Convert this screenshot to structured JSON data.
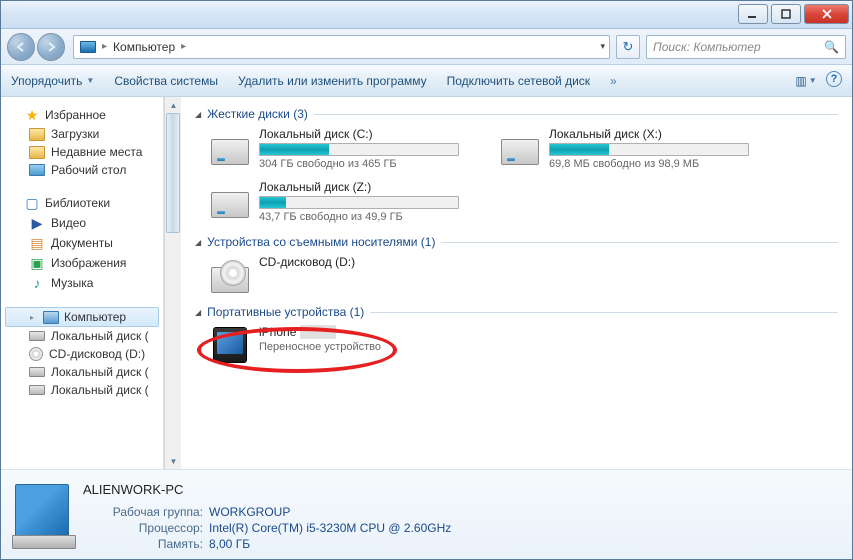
{
  "address": {
    "location": "Компьютер",
    "search_placeholder": "Поиск: Компьютер"
  },
  "toolbar": {
    "organize": "Упорядочить",
    "sysprops": "Свойства системы",
    "uninstall": "Удалить или изменить программу",
    "netdrive": "Подключить сетевой диск"
  },
  "sidebar": {
    "favorites": {
      "label": "Избранное",
      "downloads": "Загрузки",
      "recent": "Недавние места",
      "desktop": "Рабочий стол"
    },
    "libraries": {
      "label": "Библиотеки",
      "video": "Видео",
      "documents": "Документы",
      "pictures": "Изображения",
      "music": "Музыка"
    },
    "computer": {
      "label": "Компьютер",
      "c": "Локальный диск (",
      "d": "CD-дисковод (D:)",
      "x": "Локальный диск (",
      "z": "Локальный диск ("
    }
  },
  "sections": {
    "hdd": "Жесткие диски (3)",
    "removable": "Устройства со съемными носителями (1)",
    "portable": "Портативные устройства (1)"
  },
  "drives": {
    "c": {
      "name": "Локальный диск (C:)",
      "stat": "304 ГБ свободно из 465 ГБ",
      "fill": 35
    },
    "x": {
      "name": "Локальный диск (X:)",
      "stat": "69,8 МБ свободно из 98,9 МБ",
      "fill": 30
    },
    "z": {
      "name": "Локальный диск (Z:)",
      "stat": "43,7 ГБ свободно из 49,9 ГБ",
      "fill": 13
    },
    "d": {
      "name": "CD-дисковод (D:)"
    },
    "iphone": {
      "name": "iPhone",
      "sub": "Переносное устройство"
    }
  },
  "details": {
    "pcname": "ALIENWORK-PC",
    "workgroup_label": "Рабочая группа:",
    "workgroup": "WORKGROUP",
    "cpu_label": "Процессор:",
    "cpu": "Intel(R) Core(TM) i5-3230M CPU @ 2.60GHz",
    "ram_label": "Память:",
    "ram": "8,00 ГБ"
  }
}
